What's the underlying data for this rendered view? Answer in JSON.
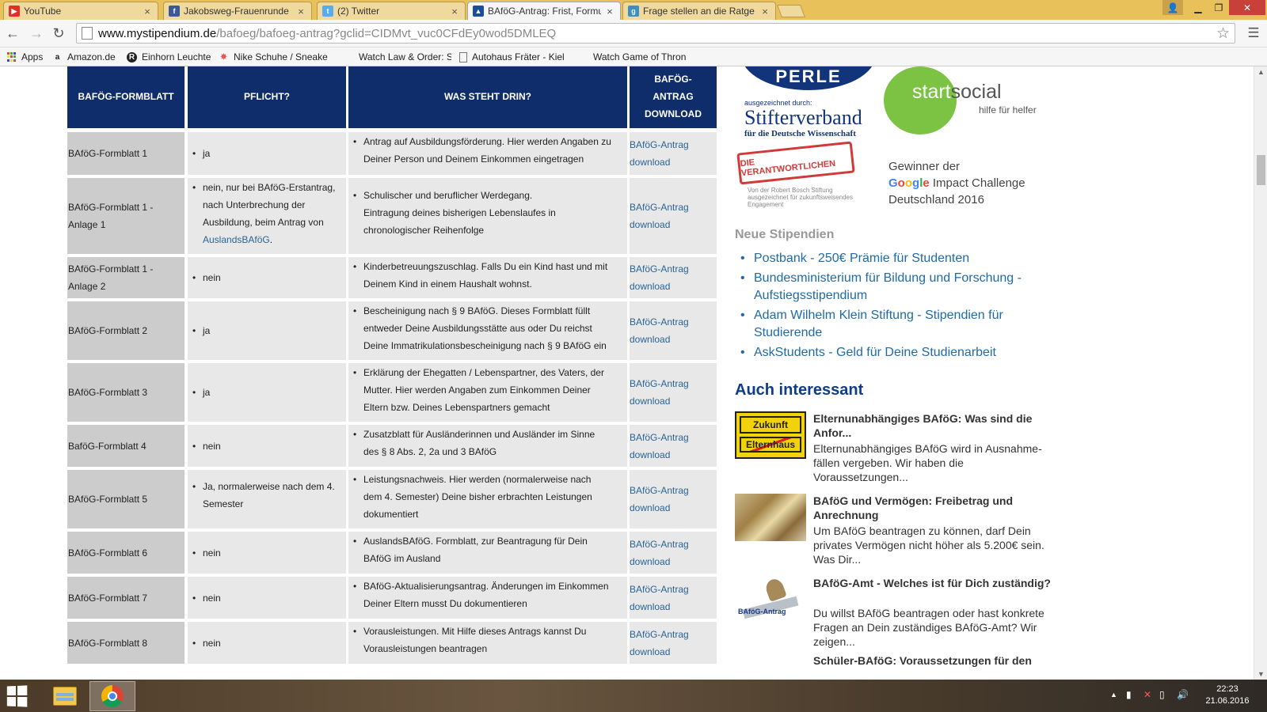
{
  "browser": {
    "tabs": [
      {
        "title": "YouTube",
        "favicon": "youtube-icon"
      },
      {
        "title": "Jakobsweg-Frauenrunde",
        "favicon": "facebook-icon"
      },
      {
        "title": "(2) Twitter",
        "favicon": "twitter-icon"
      },
      {
        "title": "BAföG-Antrag: Frist, Formu",
        "favicon": "mystipendium-icon",
        "active": true
      },
      {
        "title": "Frage stellen an die Ratge",
        "favicon": "gutefrage-icon"
      }
    ],
    "url_host": "www.mystipendium.de",
    "url_path": "/bafoeg/bafoeg-antrag?gclid=CIDMvt_vuc0CFdEy0wod5DMLEQ",
    "bookmarks": [
      {
        "label": "Apps",
        "icon": "apps-grid-icon"
      },
      {
        "label": "Amazon.de",
        "icon": "amazon-icon"
      },
      {
        "label": "Einhorn Leuchte",
        "icon": "r-logo-icon"
      },
      {
        "label": "Nike Schuhe / Sneake",
        "icon": "nike-icon"
      },
      {
        "label": "Watch Law & Order: S",
        "icon": "blank-page-icon"
      },
      {
        "label": "Autohaus Fräter - Kiel",
        "icon": "page-icon"
      },
      {
        "label": "Watch Game of Thron",
        "icon": "blank-page-icon"
      }
    ]
  },
  "table": {
    "headers": [
      "BAFÖG-FORMBLATT",
      "PFLICHT?",
      "WAS STEHT DRIN?",
      "BAFÖG-ANTRAG DOWNLOAD"
    ],
    "download_label_1": "BAföG-Antrag",
    "download_label_2": "download",
    "rows": [
      {
        "name": "BAföG-Formblatt 1",
        "pflicht": "ja",
        "inhalt": [
          "Antrag auf Ausbildungsförderung. Hier werden Angaben zu",
          "Deiner Person und Deinem Einkommen eingetragen"
        ]
      },
      {
        "name_lines": [
          "BAföG-Formblatt 1 -",
          "Anlage 1"
        ],
        "pflicht_lines": [
          "nein, nur bei BAföG-Erstantrag,",
          "nach Unterbrechung der",
          "Ausbildung, beim Antrag von"
        ],
        "pflicht_link": "AuslandsBAföG",
        "pflicht_suffix": ".",
        "inhalt": [
          "Schulischer und beruflicher Werdegang.",
          "Eintragung deines bisherigen Lebenslaufes in",
          "chronologischer Reihenfolge"
        ]
      },
      {
        "name_lines": [
          "BAföG-Formblatt 1 -",
          "Anlage 2"
        ],
        "pflicht": "nein",
        "inhalt": [
          "Kinderbetreuungszuschlag. Falls Du ein Kind hast und mit",
          "Deinem Kind in einem Haushalt wohnst."
        ]
      },
      {
        "name": "BAföG-Formblatt 2",
        "pflicht": "ja",
        "inhalt": [
          "Bescheinigung nach § 9 BAföG. Dieses Formblatt füllt",
          "entweder Deine Ausbildungsstätte aus oder Du reichst",
          "Deine Immatrikulationsbescheinigung nach § 9 BAföG ein"
        ]
      },
      {
        "name": "BAföG-Formblatt 3",
        "pflicht": "ja",
        "inhalt": [
          "Erklärung der Ehegatten / Lebenspartner, des Vaters, der",
          "Mutter. Hier werden Angaben zum Einkommen Deiner",
          "Eltern bzw. Deines Lebenspartners gemacht"
        ]
      },
      {
        "name": "BaföG-Formblatt 4",
        "pflicht": "nein",
        "inhalt": [
          "Zusatzblatt für Ausländerinnen und Ausländer im Sinne",
          "des § 8 Abs. 2, 2a und 3 BAföG"
        ]
      },
      {
        "name": "BAföG-Formblatt 5",
        "pflicht_lines": [
          "Ja, normalerweise nach dem 4.",
          "Semester"
        ],
        "inhalt": [
          "Leistungsnachweis. Hier werden (normalerweise nach",
          "dem 4. Semester) Deine bisher erbrachten Leistungen",
          "dokumentiert"
        ]
      },
      {
        "name": "BAföG-Formblatt 6",
        "pflicht": "nein",
        "inhalt": [
          "AuslandsBAföG. Formblatt, zur Beantragung für Dein",
          "BAföG im Ausland"
        ]
      },
      {
        "name": "BAföG-Formblatt 7",
        "pflicht": "nein",
        "inhalt": [
          "BAföG-Aktualisierungsantrag. Änderungen im Einkommen",
          "Deiner Eltern musst Du dokumentieren"
        ]
      },
      {
        "name": "BAföG-Formblatt 8",
        "pflicht": "nein",
        "inhalt": [
          "Vorausleistungen. Mit Hilfe dieses Antrags kannst Du",
          "Vorausleistungen beantragen"
        ]
      }
    ]
  },
  "sidebar": {
    "perle": "PERLE",
    "stifter_small": "ausgezeichnet durch:",
    "stifter_big": "Stifterverband",
    "stifter_sub": "für die Deutsche Wissenschaft",
    "startsocial_a": "start",
    "startsocial_b": "social",
    "startsocial_tag": "hilfe für helfer",
    "verant_stamp": "DIE VERANTWORTLICHEN",
    "verant_sub": "Von der Robert Bosch Stiftung ausgezeichnet für zukunftsweisendes Engagement",
    "google_l1": "Gewinner der",
    "google_brand": "Google",
    "google_l2": " Impact Challenge",
    "google_l3": "Deutschland 2016",
    "neue_title": "Neue Stipendien",
    "neue_items": [
      "Postbank - 250€ Prämie für Studenten",
      "Bundesministerium für Bildung und Forschung - Aufstiegsstipendium",
      "Adam Wilhelm Klein Stiftung - Stipendien für Studierende",
      "AskStudents - Geld für Deine Studienarbeit"
    ],
    "auch_title": "Auch interessant",
    "teasers": [
      {
        "title": "Elternunabhängiges BAföG: Was sind die Anfor...",
        "text": "Elternunabhängiges BAföG wird in Ausnahme-fällen vergeben. Wir haben die Voraussetzungen...",
        "thumb_top": "Zukunft",
        "thumb_bottom": "Elternhaus"
      },
      {
        "title": "BAföG und Vermögen: Freibetrag und Anrechnung",
        "text": "Um BAföG beantragen zu können, darf Dein privates Vermögen nicht höher als 5.200€ sein. Was Dir..."
      },
      {
        "title": "BAföG-Amt - Welches ist für Dich zuständig?",
        "text": "Du willst BAföG beantragen oder hast konkrete Fragen an Dein zuständiges BAföG-Amt? Wir zeigen...",
        "thumb_label": "BAföG-Antrag"
      },
      {
        "title": "Schüler-BAföG: Voraussetzungen für den"
      }
    ]
  },
  "taskbar": {
    "time": "22:23",
    "date": "21.06.2016"
  },
  "colors": {
    "table_header": "#0f2d6b",
    "link": "#2a6496",
    "sidebar_link": "#1f6aa8",
    "accent_title": "#0f3d8a"
  }
}
